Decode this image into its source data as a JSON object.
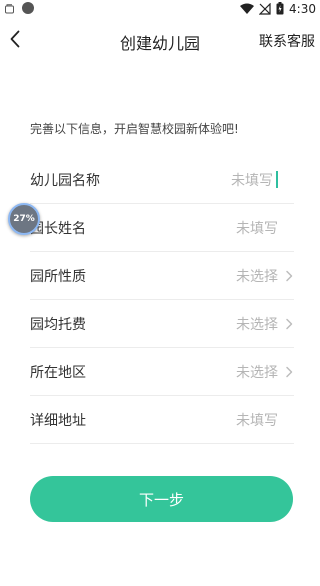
{
  "status_bar": {
    "time": "4:30",
    "icons": [
      "notification-icon",
      "dot-icon",
      "wifi-icon",
      "signal-off-icon",
      "battery-charging-icon"
    ]
  },
  "header": {
    "title": "创建幼儿园",
    "contact_label": "联系客服",
    "back_icon": "chevron-left-icon"
  },
  "intro_text": "完善以下信息，开启智慧校园新体验吧!",
  "form": {
    "rows": [
      {
        "label": "幼儿园名称",
        "value": "未填写",
        "type": "input",
        "focused": true
      },
      {
        "label": "园长姓名",
        "value": "未填写",
        "type": "input"
      },
      {
        "label": "园所性质",
        "value": "未选择",
        "type": "select"
      },
      {
        "label": "园均托费",
        "value": "未选择",
        "type": "select"
      },
      {
        "label": "所在地区",
        "value": "未选择",
        "type": "select"
      },
      {
        "label": "详细地址",
        "value": "未填写",
        "type": "input"
      }
    ]
  },
  "float_badge": {
    "text": "27%"
  },
  "next_button": {
    "label": "下一步"
  },
  "colors": {
    "accent": "#34c59a",
    "cursor": "#2fbfa0",
    "placeholder": "#b5b5b5",
    "divider": "#ececec"
  }
}
